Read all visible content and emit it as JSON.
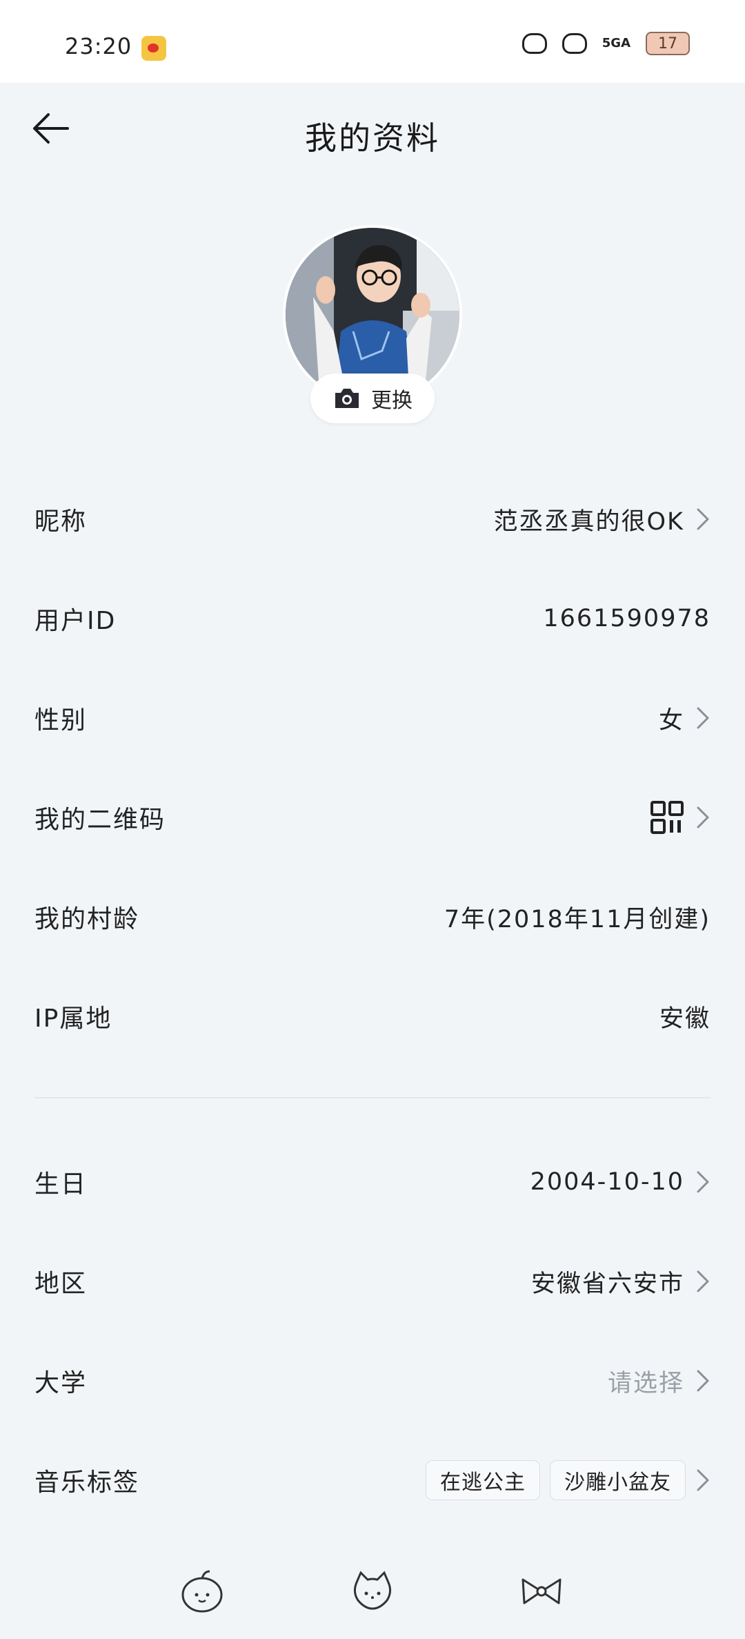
{
  "status_bar": {
    "time": "23:20",
    "signal_text": "5GA",
    "battery": "17"
  },
  "header": {
    "title": "我的资料"
  },
  "avatar": {
    "change_label": "更换"
  },
  "rows": [
    {
      "label": "昵称",
      "value": "范丞丞真的很OK"
    },
    {
      "label": "用户ID",
      "value": "1661590978"
    },
    {
      "label": "性别",
      "value": "女"
    },
    {
      "label": "我的二维码",
      "value": ""
    },
    {
      "label": "我的村龄",
      "value": "7年(2018年11月创建)"
    },
    {
      "label": "IP属地",
      "value": "安徽"
    },
    {
      "label": "生日",
      "value": "2004-10-10"
    },
    {
      "label": "地区",
      "value": "安徽省六安市"
    },
    {
      "label": "大学",
      "value": "请选择"
    },
    {
      "label": "音乐标签",
      "tags": [
        "在逃公主",
        "沙雕小盆友"
      ]
    }
  ],
  "colors": {
    "background": "#f2f5f8",
    "muted_text": "#9aa0a6",
    "avatar_shirt": "#2a5ea8"
  },
  "icons": [
    "back-arrow-icon",
    "camera-icon",
    "qr-code-icon",
    "chevron-right-icon",
    "apple-sticker-icon",
    "kitty-sticker-icon",
    "bow-sticker-icon"
  ]
}
